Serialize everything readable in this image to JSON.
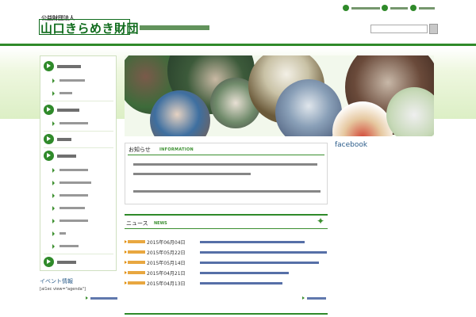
{
  "header": {
    "org_type": "公益財団法人",
    "org_name": "山口きらめき財団",
    "tagline": "",
    "top_links": [
      "",
      "",
      ""
    ],
    "search": {
      "placeholder": "",
      "button_label": ""
    }
  },
  "sidebar": {
    "groups": [
      {
        "label": "",
        "items": [
          "",
          ""
        ]
      },
      {
        "label": "",
        "items": [
          ""
        ]
      },
      {
        "label": "",
        "items": []
      },
      {
        "label": "",
        "items": [
          "",
          "",
          "",
          "",
          "",
          "",
          ""
        ]
      },
      {
        "label": "",
        "items": []
      }
    ]
  },
  "banner": {
    "alt": ""
  },
  "notice": {
    "title": "お知らせ",
    "subtitle": "INFORMATION",
    "paragraphs": [
      "",
      ""
    ]
  },
  "facebook": {
    "label": "facebook"
  },
  "news": {
    "title": "ニュース",
    "subtitle": "NEWS",
    "items": [
      {
        "category": "",
        "date": "2015年06月04日",
        "title": ""
      },
      {
        "category": "",
        "date": "2015年05月22日",
        "title": ""
      },
      {
        "category": "",
        "date": "2015年05月14日",
        "title": ""
      },
      {
        "category": "",
        "date": "2015年04月21日",
        "title": ""
      },
      {
        "category": "",
        "date": "2015年04月13日",
        "title": ""
      }
    ],
    "more_label": ""
  },
  "event": {
    "title": "イベント情報",
    "shortcode": "[ai1ec view=\"agenda\"]",
    "link_label": ""
  },
  "colors": {
    "brand_green": "#2f8a2a",
    "link_blue": "#1d3f8a",
    "category_orange": "#e08a00",
    "facebook_blue": "#2b5c8a"
  }
}
